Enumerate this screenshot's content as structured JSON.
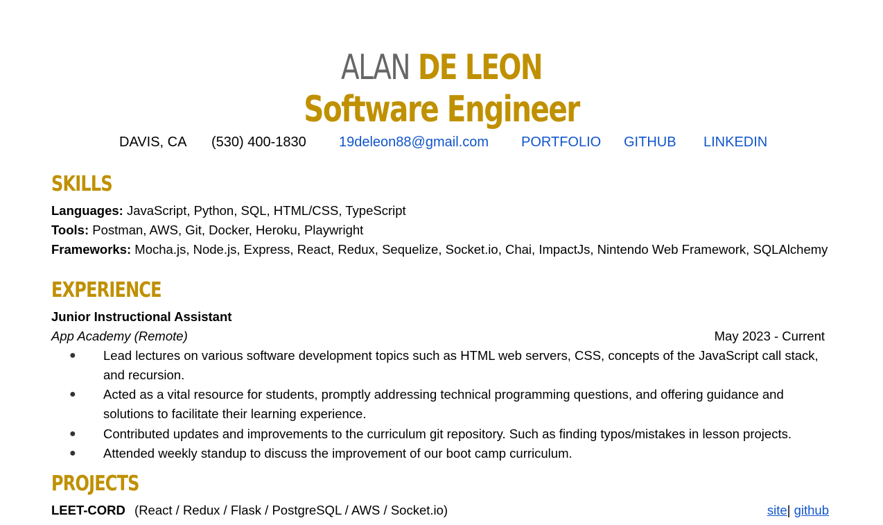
{
  "header": {
    "first_name": "ALAN",
    "last_name": "DE LEON",
    "title": "Software Engineer"
  },
  "contact": {
    "location": "DAVIS, CA",
    "phone": "(530) 400-1830",
    "email": "19deleon88@gmail.com",
    "portfolio": "PORTFOLIO",
    "github": "GITHUB",
    "linkedin": "LINKEDIN"
  },
  "skills": {
    "heading": "SKILLS",
    "languages_label": "Languages:",
    "languages": " JavaScript, Python, SQL, HTML/CSS, TypeScript",
    "tools_label": "Tools:",
    "tools": " Postman, AWS, Git, Docker, Heroku, Playwright",
    "frameworks_label": "Frameworks:",
    "frameworks": " Mocha.js, Node.js, Express, React, Redux, Sequelize, Socket.io, Chai, ImpactJs, Nintendo Web Framework, SQLAlchemy"
  },
  "experience": {
    "heading": "EXPERIENCE",
    "jobs": [
      {
        "role": "Junior Instructional Assistant",
        "company": "App Academy (Remote)",
        "dates": "May 2023 - Current",
        "bullets": [
          "Lead lectures on various software development topics such as HTML web servers, CSS, concepts of the JavaScript call stack, and recursion.",
          " Acted as a vital resource for students, promptly addressing technical programming questions, and offering guidance and solutions to facilitate their learning experience.",
          "Contributed updates and improvements to the curriculum git repository. Such as finding typos/mistakes in lesson projects.",
          "Attended weekly standup to discuss the improvement of our boot camp curriculum."
        ]
      }
    ]
  },
  "projects": {
    "heading": "PROJECTS",
    "items": [
      {
        "name": "LEET-CORD",
        "stack": "(React / Redux / Flask / PostgreSQL / AWS / Socket.io)",
        "site_label": "site",
        "separator": "|",
        "github_label": "github"
      }
    ]
  }
}
